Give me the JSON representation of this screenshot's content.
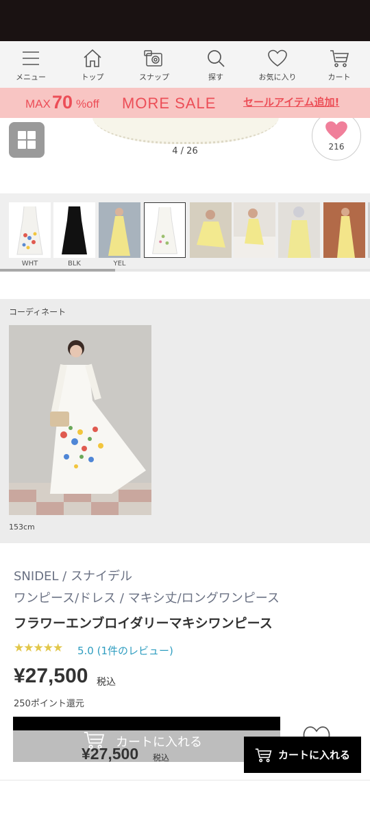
{
  "nav": {
    "items": [
      {
        "label": "メニュー",
        "icon": "menu-icon"
      },
      {
        "label": "トップ",
        "icon": "home-icon"
      },
      {
        "label": "スナップ",
        "icon": "camera-icon"
      },
      {
        "label": "探す",
        "icon": "search-icon"
      },
      {
        "label": "お気に入り",
        "icon": "heart-icon"
      },
      {
        "label": "カート",
        "icon": "cart-icon"
      }
    ]
  },
  "banner": {
    "max": "MAX",
    "percent": "70",
    "off": "%off",
    "sale": "MORE SALE",
    "link": "セールアイテム追加!",
    "color": "#ec4e57",
    "background": "#f8c5c3"
  },
  "gallery": {
    "counter": "4 / 26",
    "favorite_count": "216"
  },
  "thumbnails": {
    "labels": [
      "WHT",
      "BLK",
      "YEL"
    ]
  },
  "coordinate": {
    "title": "コーディネート",
    "height": "153cm"
  },
  "product": {
    "brand": "SNIDEL / スナイデル",
    "category": "ワンピース/ドレス / マキシ丈/ロングワンピース",
    "title": "フラワーエンブロイダリーマキシワンピース",
    "stars": "★★★★★",
    "rating_text": "5.0 (1件のレビュー)",
    "price": "¥27,500",
    "tax": "税込",
    "points": "250ポイント還元"
  },
  "cart_sticky": {
    "label": "カートに入れる",
    "price": "¥27,500",
    "tax": "税込"
  },
  "cart_float": {
    "label": "カートに入れる"
  }
}
